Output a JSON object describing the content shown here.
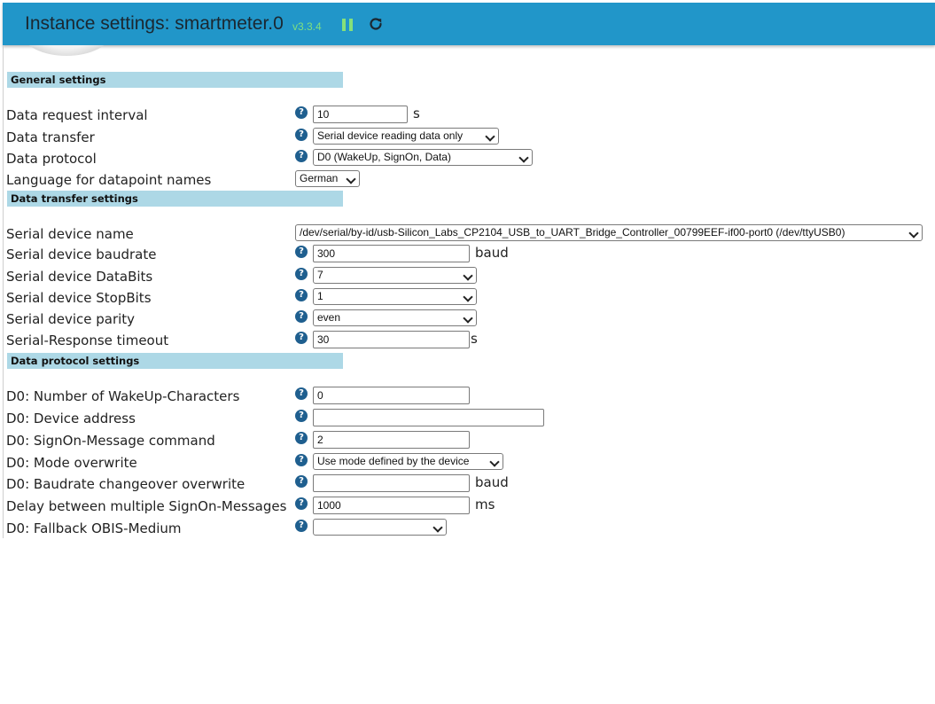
{
  "header": {
    "title": "Instance settings: smartmeter.0",
    "version": "v3.3.4"
  },
  "sections": {
    "general": "General settings",
    "transfer": "Data transfer settings",
    "protocol": "Data protocol settings"
  },
  "general": {
    "request_interval": {
      "label": "Data request interval",
      "value": "10",
      "unit": "s"
    },
    "data_transfer": {
      "label": "Data transfer",
      "value": "Serial device reading data only"
    },
    "data_protocol": {
      "label": "Data protocol",
      "value": "D0 (WakeUp, SignOn, Data)"
    },
    "language": {
      "label": "Language for datapoint names",
      "value": "German"
    }
  },
  "transfer": {
    "device_name": {
      "label": "Serial device name",
      "value": "/dev/serial/by-id/usb-Silicon_Labs_CP2104_USB_to_UART_Bridge_Controller_00799EEF-if00-port0 (/dev/ttyUSB0)"
    },
    "baudrate": {
      "label": "Serial device baudrate",
      "value": "300",
      "unit": "baud"
    },
    "databits": {
      "label": "Serial device DataBits",
      "value": "7"
    },
    "stopbits": {
      "label": "Serial device StopBits",
      "value": "1"
    },
    "parity": {
      "label": "Serial device parity",
      "value": "even"
    },
    "timeout": {
      "label": "Serial-Response timeout",
      "value": "30",
      "unit": "s"
    }
  },
  "protocol": {
    "wakeup_chars": {
      "label": "D0: Number of WakeUp-Characters",
      "value": "0"
    },
    "device_address": {
      "label": "D0: Device address",
      "value": ""
    },
    "signon_cmd": {
      "label": "D0: SignOn-Message command",
      "value": "2"
    },
    "mode_overwrite": {
      "label": "D0: Mode overwrite",
      "value": "Use mode defined by the device"
    },
    "baud_changeover": {
      "label": "D0: Baudrate changeover overwrite",
      "value": "",
      "unit": "baud"
    },
    "signon_delay": {
      "label": "Delay between multiple SignOn-Messages",
      "value": "1000",
      "unit": "ms"
    },
    "fallback_medium": {
      "label": "D0: Fallback OBIS-Medium",
      "value": ""
    }
  },
  "help_glyph": "?"
}
